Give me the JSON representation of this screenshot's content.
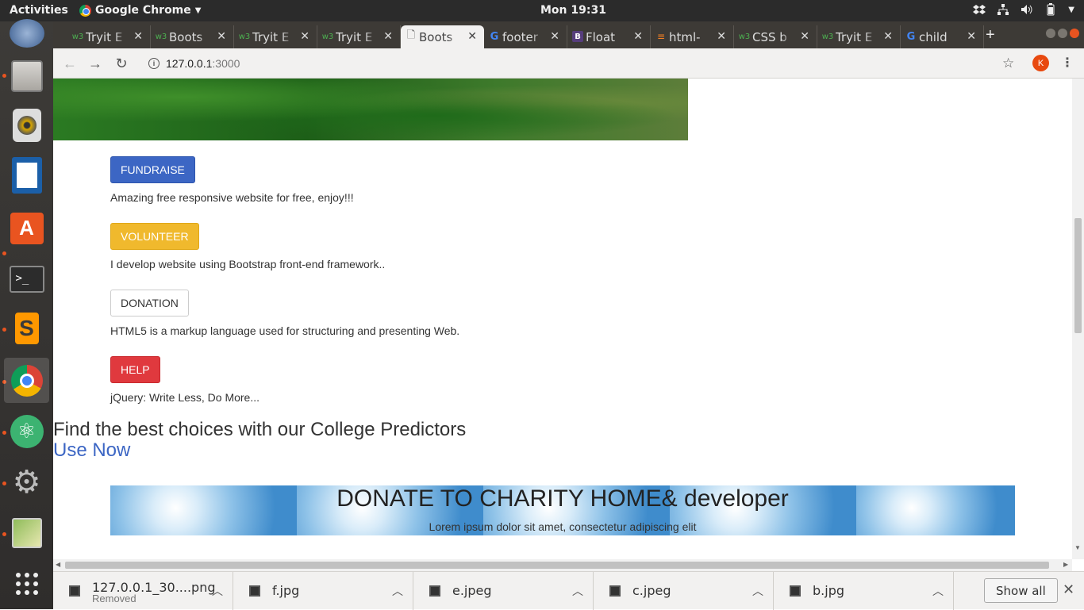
{
  "topbar": {
    "activities": "Activities",
    "app_name": "Google Chrome",
    "clock": "Mon 19:31"
  },
  "dock": {
    "items": [
      "files-icon",
      "rhythmbox-icon",
      "writer-icon",
      "software-center-icon",
      "terminal-icon",
      "sublime-text-icon",
      "chrome-icon",
      "atom-icon",
      "settings-icon",
      "image-viewer-icon",
      "app-grid-icon"
    ]
  },
  "tabs": [
    {
      "title": "Tryit E",
      "icon": "w3"
    },
    {
      "title": "Boots",
      "icon": "w3"
    },
    {
      "title": "Tryit E",
      "icon": "w3"
    },
    {
      "title": "Tryit E",
      "icon": "w3"
    },
    {
      "title": "Boots",
      "icon": "doc",
      "active": true
    },
    {
      "title": "footer",
      "icon": "google"
    },
    {
      "title": "Float",
      "icon": "bootstrap"
    },
    {
      "title": "html-",
      "icon": "stackoverflow"
    },
    {
      "title": "CSS b",
      "icon": "w3"
    },
    {
      "title": "Tryit E",
      "icon": "w3"
    },
    {
      "title": "child",
      "icon": "google"
    }
  ],
  "toolbar": {
    "url_host": "127.0.0.1",
    "url_port": ":3000",
    "avatar_letter": "K"
  },
  "page": {
    "buttons": [
      {
        "label": "FUNDRAISE",
        "desc": "Amazing free responsive website for free, enjoy!!!"
      },
      {
        "label": "VOLUNTEER",
        "desc": "I develop website using Bootstrap front-end framework.."
      },
      {
        "label": "DONATION",
        "desc": "HTML5 is a markup language used for structuring and presenting Web."
      },
      {
        "label": "HELP",
        "desc": "jQuery: Write Less, Do More..."
      }
    ],
    "predictor_title": "Find the best choices with our College Predictors",
    "use_now": "Use Now",
    "banner_title": "DONATE TO CHARITY HOME& developer",
    "banner_text": "Lorem ipsum dolor sit amet, consectetur adipiscing elit"
  },
  "downloads": {
    "items": [
      {
        "name": "127.0.0.1_30....png",
        "status": "Removed"
      },
      {
        "name": "f.jpg"
      },
      {
        "name": "e.jpeg"
      },
      {
        "name": "c.jpeg"
      },
      {
        "name": "b.jpg"
      }
    ],
    "show_all": "Show all"
  }
}
